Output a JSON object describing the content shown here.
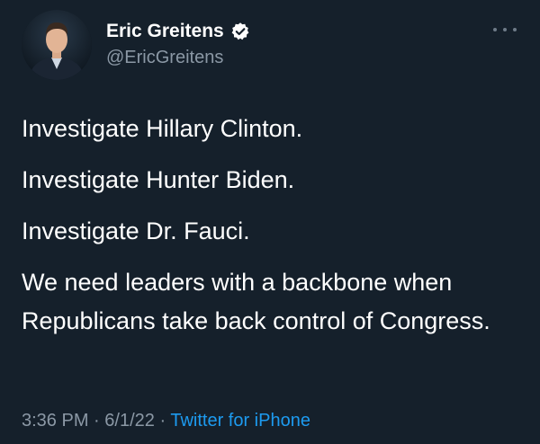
{
  "author": {
    "display_name": "Eric Greitens",
    "handle": "@EricGreitens",
    "verified_icon": "verified-badge-icon",
    "avatar_icon": "profile-photo"
  },
  "menu": {
    "icon": "more-options-icon"
  },
  "tweet": {
    "lines": [
      "Investigate Hillary Clinton.",
      "Investigate Hunter Biden.",
      "Investigate Dr. Fauci.",
      "We need leaders with a backbone when Republicans take back control of Congress."
    ]
  },
  "meta": {
    "time": "3:36 PM",
    "separator": "·",
    "date": "6/1/22",
    "source": "Twitter for iPhone"
  },
  "colors": {
    "background": "#15202b",
    "text": "#ffffff",
    "secondary_text": "#8b98a5",
    "link": "#1d9bf0"
  }
}
